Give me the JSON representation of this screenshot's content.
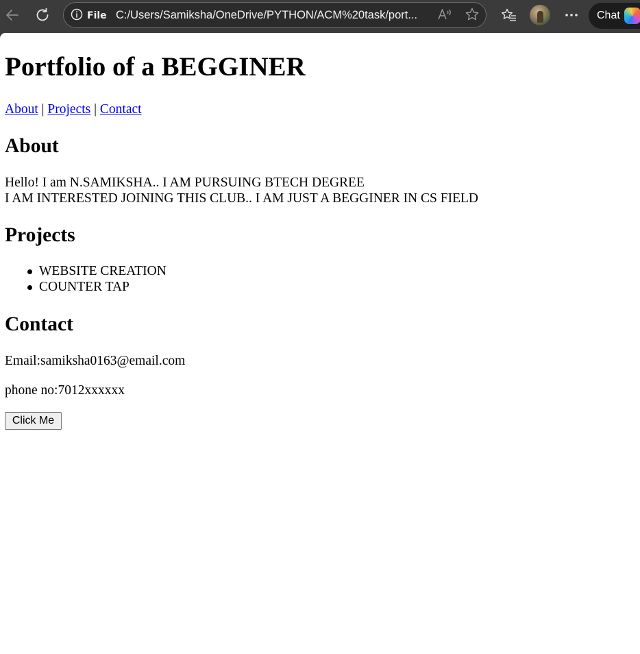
{
  "browser": {
    "url": "C:/Users/Samiksha/OneDrive/PYTHON/ACM%20task/port...",
    "site_info_label": "File",
    "chat_label": "Chat",
    "icons": [
      "back-arrow-icon",
      "refresh-icon",
      "info-icon",
      "read-aloud-icon",
      "favorite-star-icon",
      "favorites-icon",
      "profile-avatar",
      "more-icon",
      "copilot-icon"
    ]
  },
  "page": {
    "title": "Portfolio of a BEGGINER",
    "nav": {
      "links": [
        "About",
        "Projects",
        "Contact"
      ],
      "separator": "|"
    },
    "about": {
      "heading": "About",
      "lines": [
        "Hello! I am N.SAMIKSHA.. I AM PURSUING BTECH DEGREE",
        "I AM INTERESTED JOINING THIS CLUB.. I AM JUST A BEGGINER IN CS FIELD"
      ]
    },
    "projects": {
      "heading": "Projects",
      "items": [
        "WEBSITE CREATION",
        "COUNTER TAP"
      ]
    },
    "contact": {
      "heading": "Contact",
      "email": "Email:samiksha0163@email.com",
      "phone": "phone no:7012xxxxxx"
    },
    "button_label": "Click Me"
  }
}
